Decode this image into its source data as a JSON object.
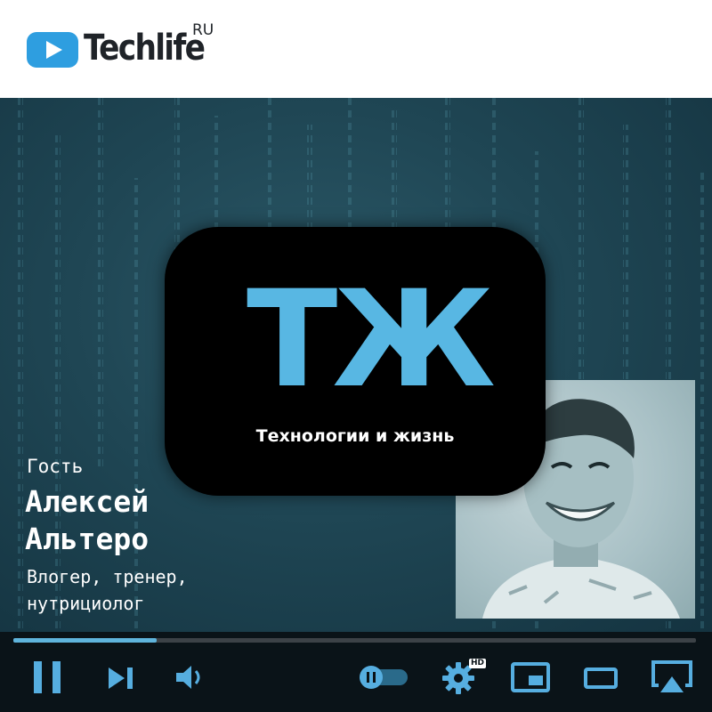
{
  "header": {
    "brand": "Techlife",
    "region": "RU",
    "logo_icon": "play-logo-icon",
    "brand_color": "#2e9ee0"
  },
  "show": {
    "logo_letters": "ТЖ",
    "tagline": "Технологии и жизнь",
    "accent": "#58b7e3"
  },
  "guest": {
    "role_label": "Гость",
    "name_first": "Алексей",
    "name_last": "Альтеро",
    "description_line1": "Влогер, тренер,",
    "description_line2": "нутрициолог"
  },
  "player": {
    "progress": 0.21,
    "state": "playing",
    "quality_badge": "HD",
    "controls": [
      {
        "name": "pause",
        "icon": "pause-icon"
      },
      {
        "name": "next",
        "icon": "skip-next-icon"
      },
      {
        "name": "volume",
        "icon": "volume-icon"
      },
      {
        "name": "autoplay-toggle",
        "icon": "toggle-icon"
      },
      {
        "name": "settings",
        "icon": "gear-icon"
      },
      {
        "name": "miniplayer",
        "icon": "miniplayer-icon"
      },
      {
        "name": "theater",
        "icon": "theater-icon"
      },
      {
        "name": "cast",
        "icon": "cast-icon"
      }
    ],
    "accent": "#56aee0"
  }
}
